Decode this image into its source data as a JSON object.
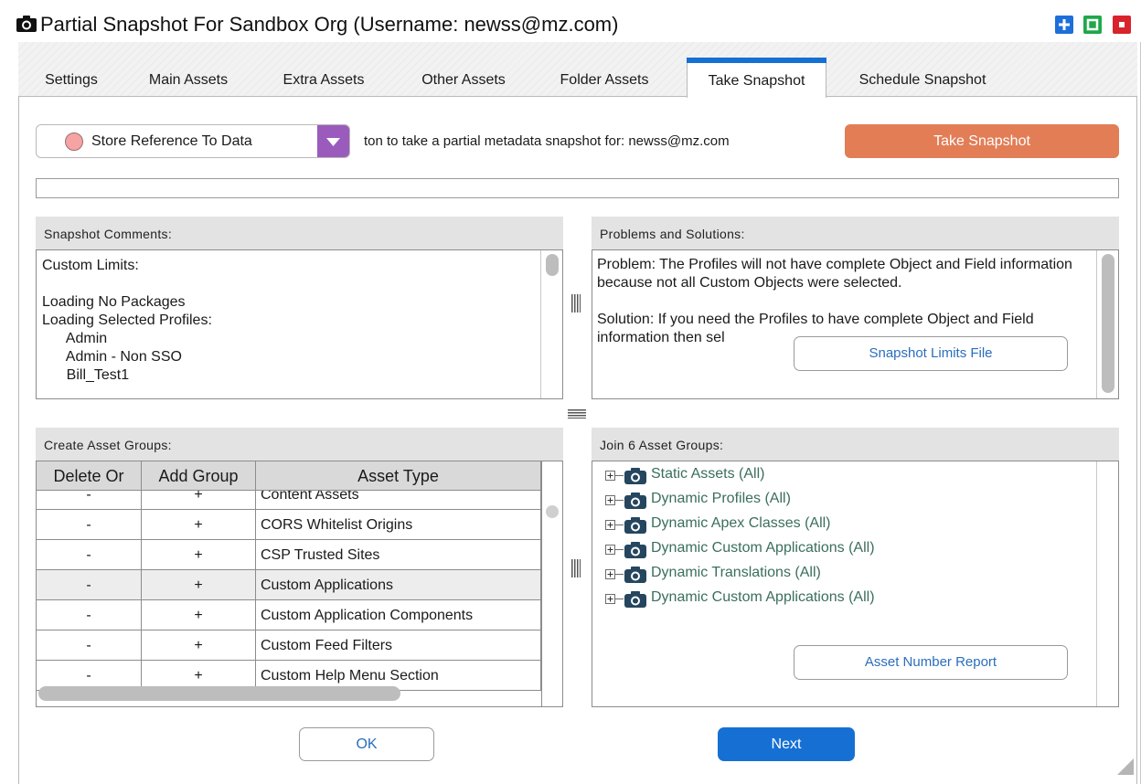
{
  "window": {
    "title": "Partial Snapshot For Sandbox Org (Username: newss@mz.com)"
  },
  "tabs": [
    {
      "label": "Settings"
    },
    {
      "label": "Main Assets"
    },
    {
      "label": "Extra Assets"
    },
    {
      "label": "Other Assets"
    },
    {
      "label": "Folder Assets"
    },
    {
      "label": "Take Snapshot",
      "active": true
    },
    {
      "label": "Schedule Snapshot"
    }
  ],
  "toolbar": {
    "store_option": "Store Reference To Data",
    "info_text": "ton to take a partial metadata snapshot for: newss@mz.com",
    "take_snapshot_label": "Take Snapshot",
    "progress": 0
  },
  "comments": {
    "header": "Snapshot Comments:",
    "lines": [
      "Custom Limits:",
      "",
      "Loading No Packages",
      "Loading Selected Profiles:",
      "      Admin",
      "      Admin - Non SSO",
      "      Bill_Test1"
    ]
  },
  "problems": {
    "header": "Problems and Solutions:",
    "problem": "Problem: The Profiles will not have complete Object and Field information because not all Custom Objects were selected.",
    "solution": "Solution: If you need the Profiles to have complete Object and Field information then sel",
    "limits_button": "Snapshot Limits File"
  },
  "asset_groups": {
    "header": "Create Asset Groups:",
    "columns": [
      "Delete Or",
      "Add Group",
      "Asset Type"
    ],
    "partial_row": {
      "delete": "-",
      "add": "+",
      "type": "Content Assets"
    },
    "rows": [
      {
        "delete": "-",
        "add": "+",
        "type": "CORS Whitelist Origins"
      },
      {
        "delete": "-",
        "add": "+",
        "type": "CSP Trusted Sites"
      },
      {
        "delete": "-",
        "add": "+",
        "type": "Custom Applications",
        "selected": true
      },
      {
        "delete": "-",
        "add": "+",
        "type": "Custom Application Components"
      },
      {
        "delete": "-",
        "add": "+",
        "type": "Custom Feed Filters"
      },
      {
        "delete": "-",
        "add": "+",
        "type": "Custom Help Menu Section"
      }
    ]
  },
  "join_groups": {
    "header": "Join 6 Asset Groups:",
    "items": [
      "Static Assets (All)",
      "Dynamic Profiles (All)",
      "Dynamic Apex Classes (All)",
      "Dynamic Custom Applications (All)",
      "Dynamic Translations (All)",
      "Dynamic Custom Applications (All)"
    ],
    "report_button": "Asset Number Report"
  },
  "footer": {
    "ok_label": "OK",
    "next_label": "Next"
  },
  "colors": {
    "accent": "#1670d4",
    "take_snapshot": "#e27d56",
    "dropdown_arrow": "#9b5bbd",
    "tree_text": "#3a6e5e",
    "link_text": "#2a6ebd"
  }
}
